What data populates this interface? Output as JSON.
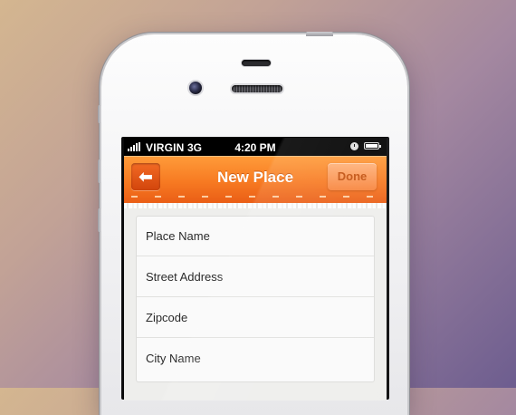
{
  "status_bar": {
    "carrier": "VIRGIN",
    "network": "3G",
    "time": "4:20 PM",
    "icons": [
      "signal-bars-icon",
      "clock-icon",
      "battery-icon"
    ]
  },
  "navbar": {
    "title": "New Place",
    "back_icon": "arrow-left-icon",
    "back_glyph": "⬅",
    "done_label": "Done",
    "accent_color": "#f77a22"
  },
  "form": {
    "fields": [
      {
        "placeholder": "Place Name"
      },
      {
        "placeholder": "Street Address"
      },
      {
        "placeholder": "Zipcode"
      },
      {
        "placeholder": "City Name"
      }
    ]
  }
}
